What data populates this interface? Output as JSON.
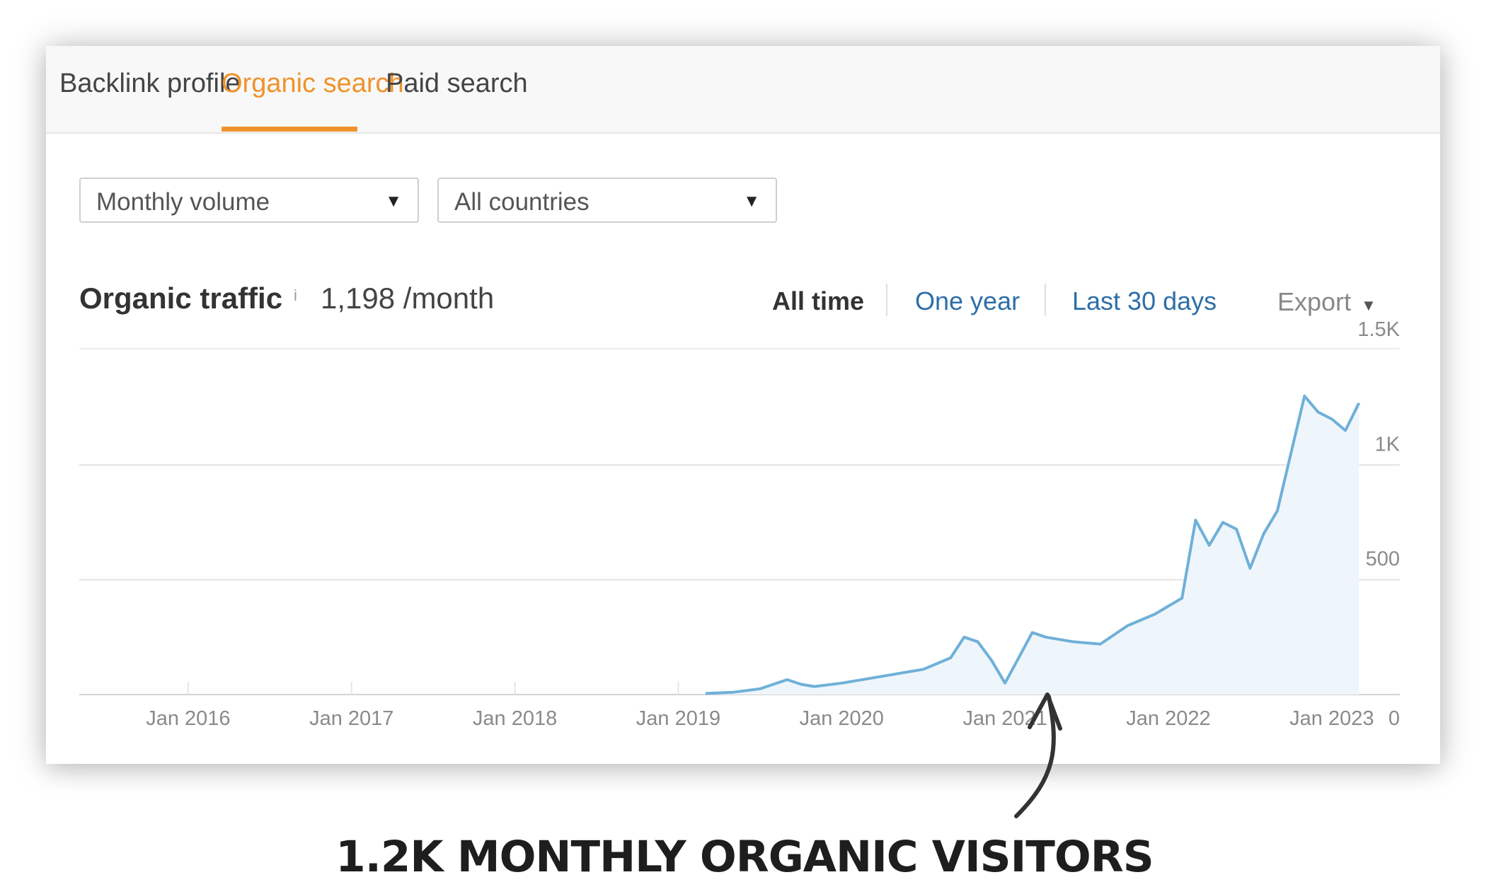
{
  "tabs": [
    {
      "label": "Backlink profile"
    },
    {
      "label": "Organic search",
      "active": true
    },
    {
      "label": "Paid search"
    }
  ],
  "filters": {
    "volume_select": "Monthly volume",
    "country_select": "All countries"
  },
  "metric": {
    "title": "Organic traffic",
    "info_icon": "i",
    "value": "1,198 /month"
  },
  "ranges": [
    {
      "label": "All time",
      "active": true
    },
    {
      "label": "One year"
    },
    {
      "label": "Last 30 days"
    }
  ],
  "export_label": "Export",
  "caption": "1.2K MONTHLY ORGANIC VISITORS",
  "colors": {
    "accent_orange": "#f0922b",
    "link_blue": "#2e6ea7",
    "line_blue": "#6fb0d8",
    "area_fill": "#eef6fc"
  },
  "icons": {
    "dropdown": "caret-down-icon",
    "export": "caret-down-icon",
    "annotation": "curved-arrow-icon"
  },
  "chart_data": {
    "type": "area",
    "title": "",
    "xlabel": "",
    "ylabel": "",
    "x_ticks": [
      "Jan 2016",
      "Jan 2017",
      "Jan 2018",
      "Jan 2019",
      "Jan 2020",
      "Jan 2021",
      "Jan 2022",
      "Jan 2023"
    ],
    "y_ticks": [
      "0",
      "500",
      "1K",
      "1.5K"
    ],
    "ylim": [
      0,
      1500
    ],
    "xlim": [
      "2015-05",
      "2023-06"
    ],
    "grid": true,
    "y_axis_side": "right",
    "series": [
      {
        "x": [
          "2019-03",
          "2019-05",
          "2019-07",
          "2019-09",
          "2019-10",
          "2019-11",
          "2020-01",
          "2020-03",
          "2020-05",
          "2020-07",
          "2020-09",
          "2020-10",
          "2020-11",
          "2020-12",
          "2021-01",
          "2021-02",
          "2021-03",
          "2021-04",
          "2021-06",
          "2021-08",
          "2021-09",
          "2021-10",
          "2021-12",
          "2022-02",
          "2022-03",
          "2022-04",
          "2022-05",
          "2022-06",
          "2022-07",
          "2022-08",
          "2022-09",
          "2022-10",
          "2022-11",
          "2022-12",
          "2023-01",
          "2023-02",
          "2023-03"
        ],
        "values": [
          5,
          10,
          25,
          65,
          45,
          35,
          50,
          70,
          90,
          110,
          160,
          250,
          230,
          150,
          50,
          160,
          270,
          250,
          230,
          220,
          260,
          300,
          350,
          420,
          760,
          650,
          750,
          720,
          550,
          700,
          800,
          1050,
          1300,
          1230,
          1200,
          1150,
          1270
        ]
      }
    ]
  }
}
